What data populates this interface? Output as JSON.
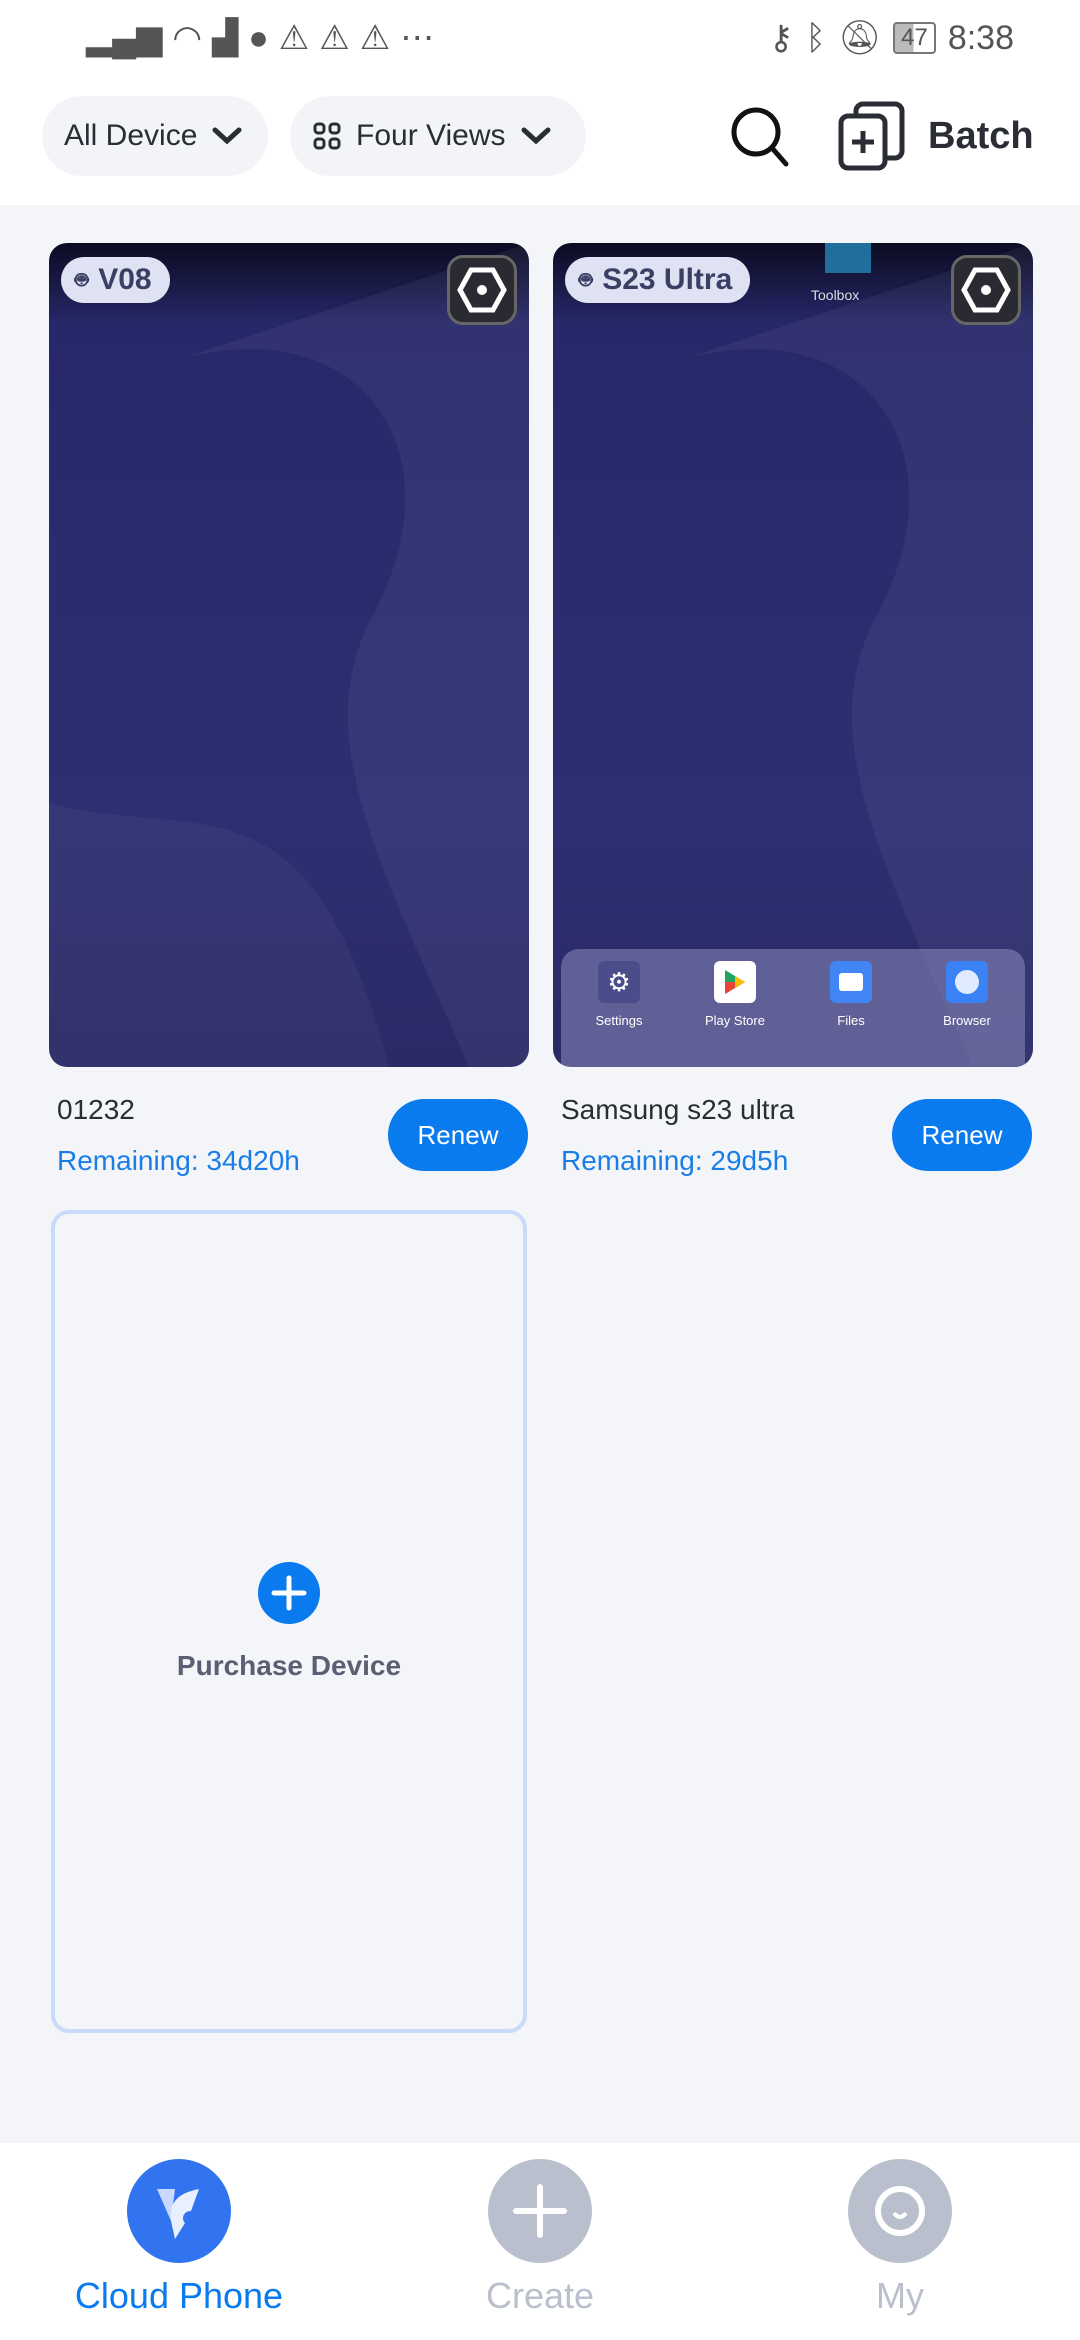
{
  "status_bar": {
    "time": "8:38",
    "battery": "47",
    "left_icons": [
      "signal-icon",
      "wifi-icon",
      "cat-icon",
      "shazam-icon",
      "warning-icon",
      "warning-icon",
      "warning-icon",
      "more-icon"
    ],
    "right_icons": [
      "key-icon",
      "bluetooth-icon",
      "bell-off-icon",
      "battery-icon"
    ]
  },
  "toolbar": {
    "device_filter": "All Device",
    "view_mode": "Four Views",
    "batch_label": "Batch"
  },
  "devices": [
    {
      "badge": "V08",
      "name": "01232",
      "remaining": "Remaining: 34d20h",
      "renew": "Renew"
    },
    {
      "badge": "S23 Ultra",
      "name": "Samsung s23 ultra",
      "remaining": "Remaining: 29d5h",
      "renew": "Renew",
      "screen_label": "Toolbox",
      "dock_apps": [
        "Settings",
        "Play Store",
        "Files",
        "Browser"
      ]
    }
  ],
  "purchase": {
    "label": "Purchase Device"
  },
  "nav": {
    "items": [
      {
        "label": "Cloud Phone",
        "active": true
      },
      {
        "label": "Create",
        "active": false
      },
      {
        "label": "My",
        "active": false
      }
    ]
  },
  "colors": {
    "accent": "#0a7aef",
    "inactive": "#b9bfcc",
    "background": "#f3f5f9"
  }
}
